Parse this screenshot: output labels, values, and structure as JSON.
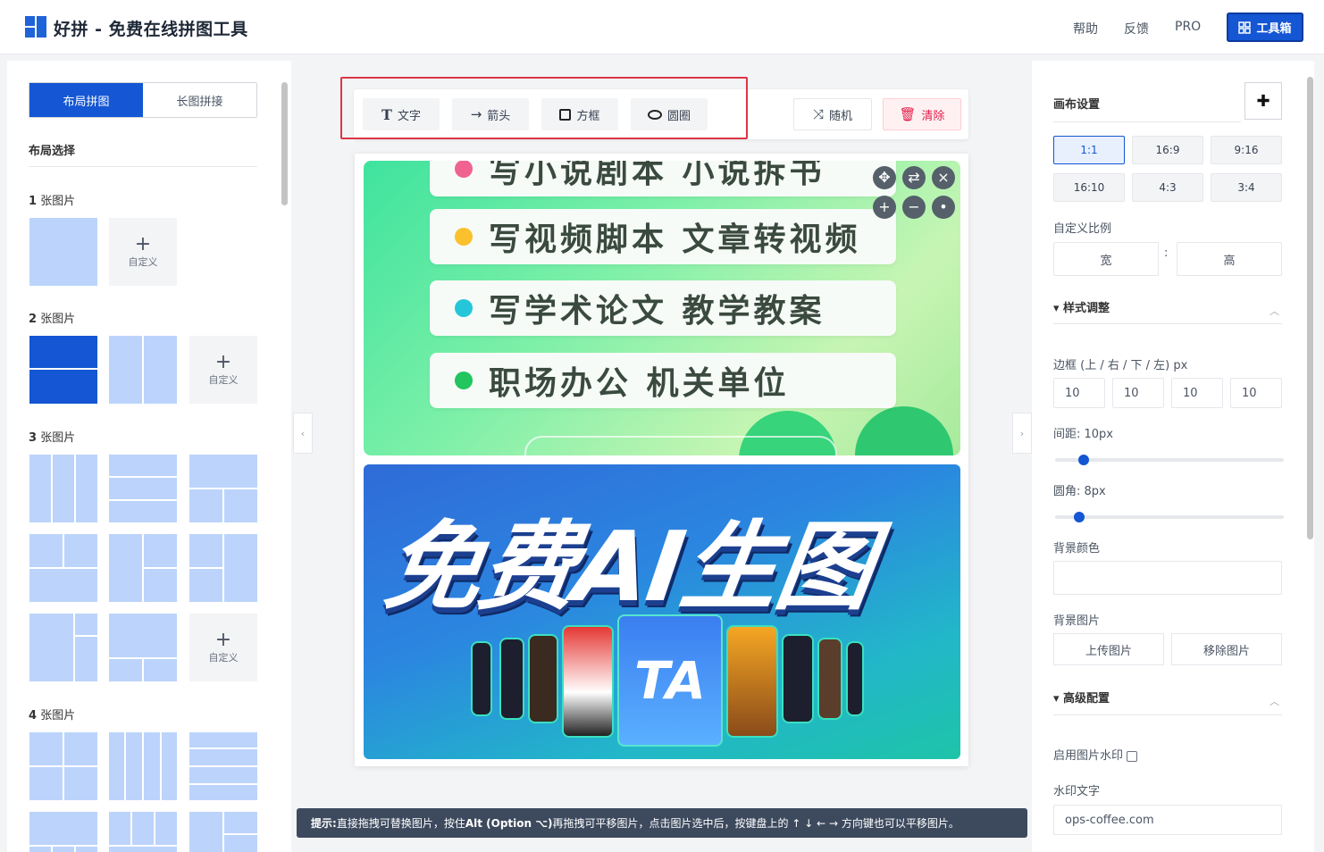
{
  "header": {
    "title": "好拼 - 免费在线拼图工具",
    "nav": [
      "帮助",
      "反馈",
      "PRO"
    ],
    "toolbox_label": "工具箱",
    "brand_color": "#1456d3"
  },
  "left": {
    "tabs": [
      "布局拼图",
      "长图拼接"
    ],
    "layout_section": "布局选择",
    "groups": [
      {
        "count": "1",
        "unit": "张图片"
      },
      {
        "count": "2",
        "unit": "张图片"
      },
      {
        "count": "3",
        "unit": "张图片"
      },
      {
        "count": "4",
        "unit": "张图片"
      }
    ],
    "custom_label": "自定义"
  },
  "toolbar": {
    "text": "文字",
    "arrow": "箭头",
    "box": "方框",
    "circle": "圆圈",
    "random": "随机",
    "clear": "清除"
  },
  "canvas": {
    "image1_rows": [
      {
        "text": "写小说剧本  小说拆书",
        "dot": "#f06292"
      },
      {
        "text": "写视频脚本  文章转视频",
        "dot": "#fbc02d"
      },
      {
        "text": "写学术论文  教学教案",
        "dot": "#26c6da"
      },
      {
        "text": "职场办公  机关单位",
        "dot": "#22c55e"
      }
    ],
    "image2_text": "免费AI生图",
    "image2_logo": "TA"
  },
  "hint": {
    "prefix": "提示:",
    "body": " 直接拖拽可替换图片，按住 ",
    "key": "Alt (Option ⌥)",
    "rest": " 再拖拽可平移图片，点击图片选中后，按键盘上的 ↑ ↓ ← → 方向键也可以平移图片。"
  },
  "right": {
    "canvas_settings": "画布设置",
    "ratios": [
      "1:1",
      "16:9",
      "9:16",
      "16:10",
      "4:3",
      "3:4"
    ],
    "active_ratio": "1:1",
    "custom_ratio": "自定义比例",
    "width_placeholder": "宽",
    "height_placeholder": "高",
    "ratio_sep": ":",
    "style_section": "▾ 样式调整",
    "border_label": "边框 (上 / 右 / 下 / 左) px",
    "border_values": [
      "10",
      "10",
      "10",
      "10"
    ],
    "gap_label": "间距: 10px",
    "gap_value": 10,
    "radius_label": "圆角: 8px",
    "radius_value": 8,
    "bg_color_label": "背景颜色",
    "bg_image_label": "背景图片",
    "upload_label": "上传图片",
    "remove_label": "移除图片",
    "advanced_section": "▾ 高级配置",
    "watermark_enable": "启用图片水印",
    "watermark_text_label": "水印文字",
    "watermark_text_value": "ops-coffee.com"
  }
}
